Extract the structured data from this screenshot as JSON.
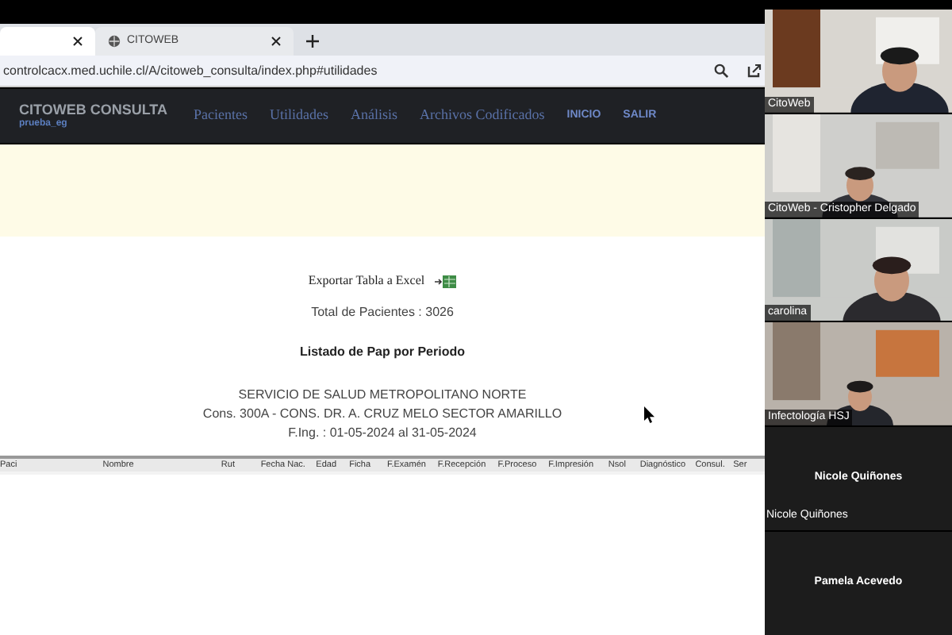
{
  "browser": {
    "tabs": [
      {
        "selected": true
      },
      {
        "title": "CITOWEB",
        "selected": false
      }
    ],
    "address": "controlcacx.med.uchile.cl/A/citoweb_consulta/index.php#utilidades"
  },
  "site": {
    "brand": "CITOWEB CONSULTA",
    "user": "prueba_eg",
    "nav": [
      {
        "label": "Pacientes",
        "kind": "serif"
      },
      {
        "label": "Utilidades",
        "kind": "serif"
      },
      {
        "label": "Análisis",
        "kind": "serif"
      },
      {
        "label": "Archivos Codificados",
        "kind": "serif"
      },
      {
        "label": "INICIO",
        "kind": "caps"
      },
      {
        "label": "SALIR",
        "kind": "caps"
      }
    ]
  },
  "report": {
    "export": "Exportar Tabla a Excel",
    "total": "Total de Pacientes : 3026",
    "title": "Listado de Pap por Periodo",
    "lines": [
      "SERVICIO DE SALUD METROPOLITANO NORTE",
      "Cons. 300A - CONS. DR. A. CRUZ MELO SECTOR AMARILLO",
      "F.Ing. : 01-05-2024 al 31-05-2024"
    ]
  },
  "table": {
    "columns": [
      "Paci",
      "Nombre",
      "Rut",
      "Fecha Nac.",
      "Edad",
      "Ficha",
      "F.Examén",
      "F.Recepción",
      "F.Proceso",
      "F.Impresión",
      "Nsol",
      "Diagnóstico",
      "Consul.",
      "Ser"
    ]
  },
  "participants": [
    {
      "name": "CitoWeb",
      "kind": "video"
    },
    {
      "name": "CitoWeb - Cristopher Delgado",
      "kind": "video"
    },
    {
      "name": "carolina",
      "kind": "video"
    },
    {
      "name": "Infectología HSJ",
      "kind": "video"
    },
    {
      "name": "Nicole Quiñones",
      "label": "Nicole Quiñones",
      "kind": "audio"
    },
    {
      "name": "Pamela Acevedo",
      "kind": "audio"
    }
  ]
}
